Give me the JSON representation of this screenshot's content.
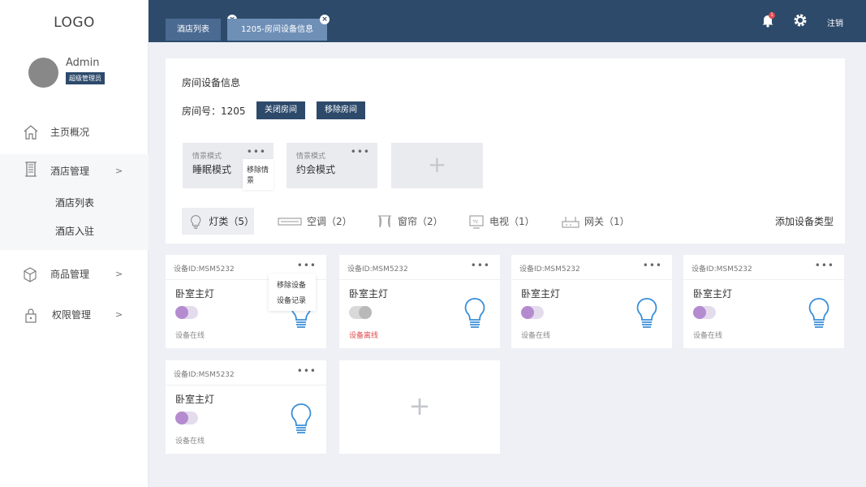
{
  "sidebar": {
    "logo": "LOGO",
    "user": {
      "name": "Admin",
      "role": "超级管理员"
    },
    "nav": [
      {
        "label": "主页概况",
        "icon": "home-icon",
        "arrow": ""
      },
      {
        "label": "酒店管理",
        "icon": "building-icon",
        "arrow": ">"
      },
      {
        "label": "商品管理",
        "icon": "cube-icon",
        "arrow": ">"
      },
      {
        "label": "权限管理",
        "icon": "lock-icon",
        "arrow": ">"
      }
    ],
    "sub_items": [
      "酒店列表",
      "酒店入驻"
    ]
  },
  "header": {
    "tabs": [
      {
        "label": "酒店列表",
        "close": "×"
      },
      {
        "label": "1205-房间设备信息",
        "close": "×"
      }
    ],
    "notification_count": "1",
    "logout": "注销"
  },
  "room": {
    "title": "房间设备信息",
    "label": "房间号：",
    "number": "1205",
    "close_button": "关闭房间",
    "remove_button": "移除房间"
  },
  "scenes": [
    {
      "sub": "情景模式",
      "name": "睡眠模式",
      "menu": "•••",
      "popup": "移除情景"
    },
    {
      "sub": "情景模式",
      "name": "约会模式",
      "menu": "•••"
    }
  ],
  "scene_add": "+",
  "device_types": [
    {
      "label": "灯类（5）",
      "icon": "bulb-icon"
    },
    {
      "label": "空调（2）",
      "icon": "air-conditioner-icon"
    },
    {
      "label": "窗帘（2）",
      "icon": "curtain-icon"
    },
    {
      "label": "电视（1）",
      "icon": "tv-icon"
    },
    {
      "label": "网关（1）",
      "icon": "gateway-icon"
    }
  ],
  "add_device_type": "添加设备类型",
  "devices": [
    {
      "id": "设备ID:MSM5232",
      "name": "卧室主灯",
      "status": "设备在线",
      "on": true,
      "menu": "•••"
    },
    {
      "id": "设备ID:MSM5232",
      "name": "卧室主灯",
      "status": "设备离线",
      "on": false,
      "menu": "•••"
    },
    {
      "id": "设备ID:MSM5232",
      "name": "卧室主灯",
      "status": "设备在线",
      "on": true,
      "menu": "•••"
    },
    {
      "id": "设备ID:MSM5232",
      "name": "卧室主灯",
      "status": "设备在线",
      "on": true,
      "menu": "•••"
    },
    {
      "id": "设备ID:MSM5232",
      "name": "卧室主灯",
      "status": "设备在线",
      "on": true,
      "menu": "•••"
    }
  ],
  "device_menu": {
    "remove": "移除设备",
    "records": "设备记录"
  },
  "device_add": "+",
  "colors": {
    "primary": "#2d4a6b",
    "toggle_on": "#b58bd0",
    "bulb": "#3a8fd8",
    "offline": "#e04b4b"
  }
}
